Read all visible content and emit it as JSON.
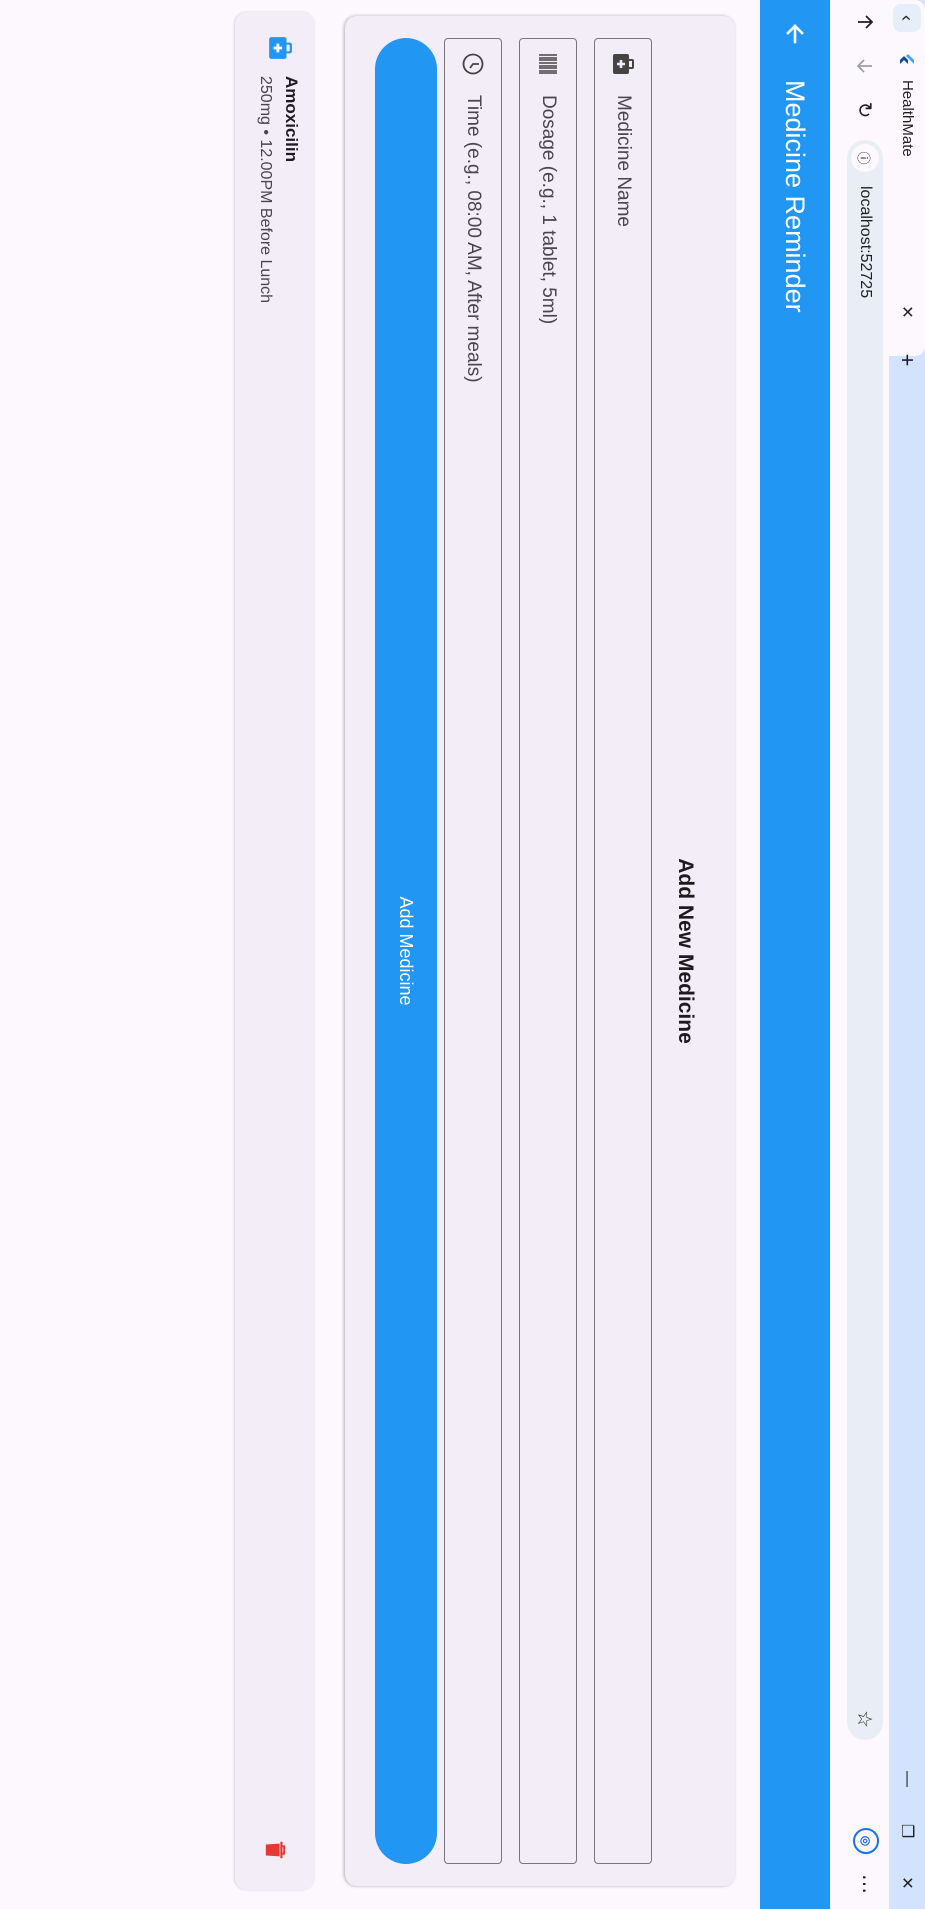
{
  "browser": {
    "tab_title": "HealthMate",
    "url": "localhost:52725",
    "tab_scroll_glyph": "‹",
    "tab_close_glyph": "✕",
    "new_tab_glyph": "+",
    "minimize_glyph": "—",
    "maximize_glyph": "❐",
    "close_window_glyph": "✕",
    "back_glyph": "↑",
    "forward_glyph": "↓",
    "reload_glyph": "↻",
    "site_info_glyph": "ⓘ",
    "bookmark_glyph": "☆",
    "menu_glyph": "⋯"
  },
  "appbar": {
    "title": "Medicine Reminder",
    "background": "#2196f3"
  },
  "form": {
    "title": "Add New Medicine",
    "fields": [
      {
        "placeholder": "Medicine Name",
        "icon": "medical-bag-icon"
      },
      {
        "placeholder": "Dosage (e.g., 1 tablet, 5ml)",
        "icon": "barcode-icon"
      },
      {
        "placeholder": "Time (e.g., 08:00 AM, After meals)",
        "icon": "clock-icon"
      }
    ],
    "submit_label": "Add Medicine"
  },
  "medicines": [
    {
      "name": "Amoxicilin",
      "detail": "250mg • 12.00PM Before Lunch",
      "icon": "medical-bag-icon",
      "delete_icon": "trash-icon",
      "delete_color": "#e53935"
    }
  ]
}
